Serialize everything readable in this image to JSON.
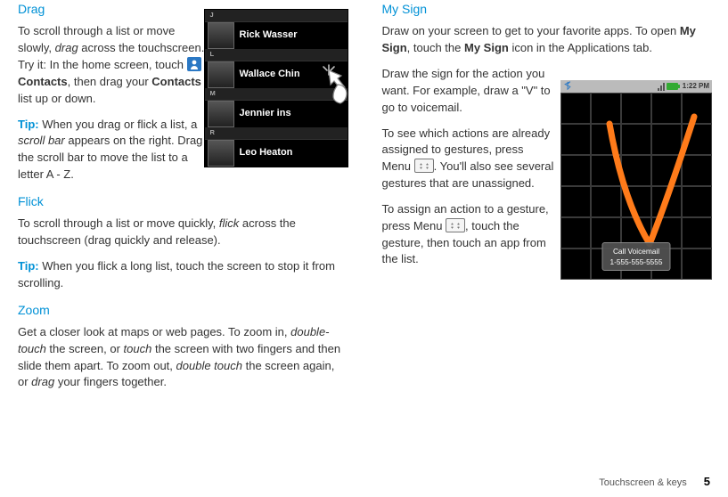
{
  "left": {
    "drag": {
      "h": "Drag",
      "p1a": "To scroll through a list or move slowly, ",
      "p1_em1": "drag",
      "p1b": " across the touchscreen. Try it: In the home screen, touch ",
      "contacts_lbl": "Contacts",
      "p1c": ", then drag your ",
      "contacts2": "Contacts",
      "p1d": " list up or down.",
      "tip_lbl": "Tip:",
      "tip_a": " When you drag or flick a list, a ",
      "tip_em": "scroll bar",
      "tip_b": " appears on the right. Drag the scroll bar to move the list to a letter A - Z.",
      "contacts_list": {
        "letters": [
          "J",
          "L",
          "M",
          "R"
        ],
        "names": [
          "Rick Wasser",
          "Wallace Chin",
          "Jennier     ins",
          "Leo Heaton"
        ]
      }
    },
    "flick": {
      "h": "Flick",
      "p_a": "To scroll through a list or move quickly, ",
      "p_em": "flick",
      "p_b": " across the touchscreen (drag quickly and release).",
      "tip_lbl": "Tip:",
      "tip": " When you flick a long list, touch the screen to stop it from scrolling."
    },
    "zoom": {
      "h": "Zoom",
      "p_a": "Get a closer look at maps or web pages. To zoom in, ",
      "em1": "double-touch",
      "p_b": " the screen, or ",
      "em2": "touch",
      "p_c": " the screen with two fingers and then slide them apart. To zoom out, ",
      "em3": "double touch",
      "p_d": " the screen again, or ",
      "em4": "drag",
      "p_e": " your fingers together."
    }
  },
  "right": {
    "mysign": {
      "h": "My Sign",
      "p1_a": "Draw on your screen to get to your favorite apps. To open ",
      "b1": "My Sign",
      "p1_b": ", touch the ",
      "b2": "My Sign",
      "p1_c": " icon in the Applications tab.",
      "p2": "Draw the sign for the action you want. For example, draw a \"V\" to go to voicemail.",
      "p3_a": "To see which actions are already assigned to gestures, press Menu ",
      "p3_b": ". You'll also see several gestures that are unassigned.",
      "p4_a": "To assign an action to a gesture, press Menu ",
      "p4_b": ", touch the gesture, then touch an app from the list.",
      "status_time": "1:22 PM",
      "caption_l1": "Call Voicemail",
      "caption_l2": "1-555-555-5555"
    }
  },
  "footer": {
    "section": "Touchscreen & keys",
    "page": "5"
  }
}
